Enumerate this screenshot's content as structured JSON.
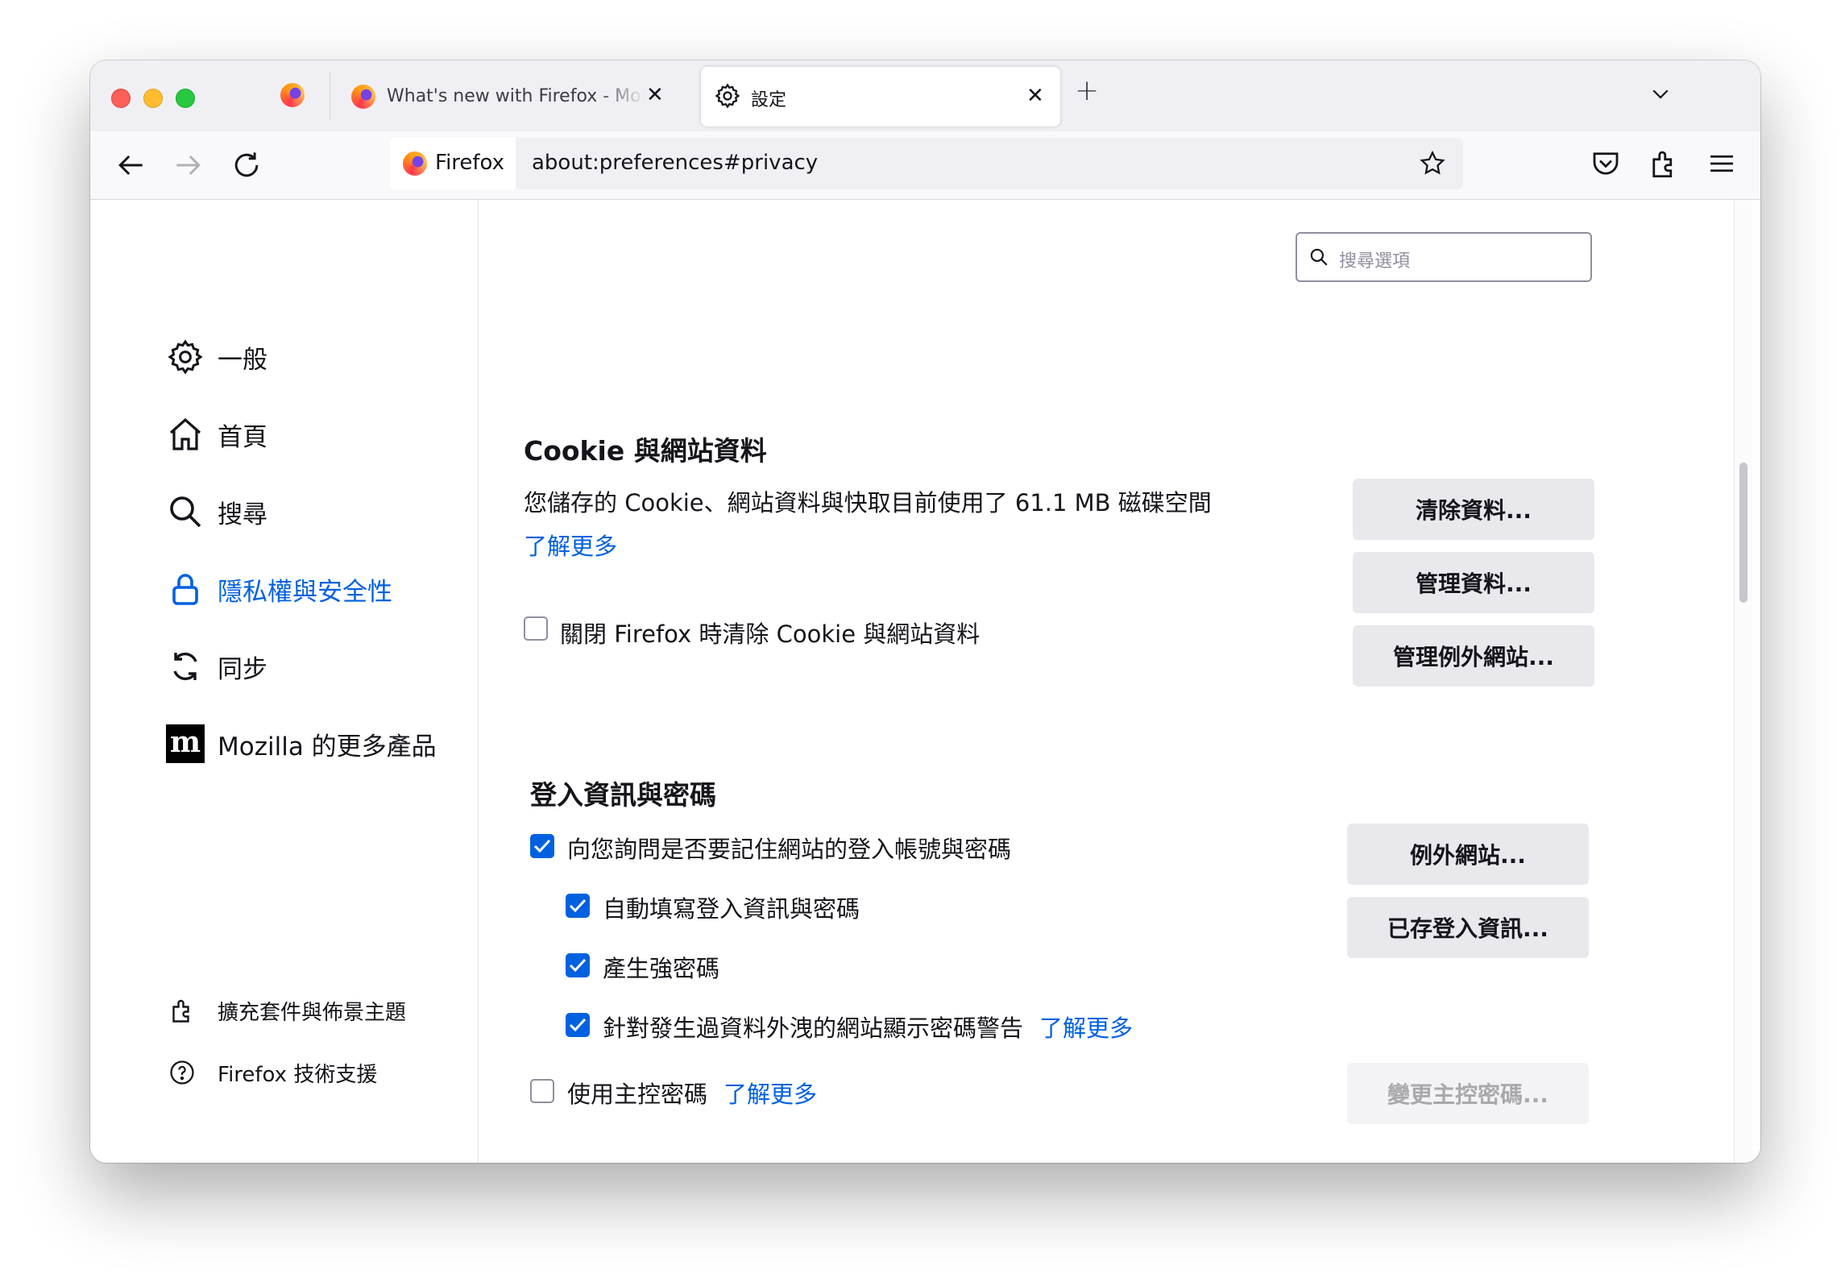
{
  "tabs": [
    {
      "title": "What's new with Firefox - More privacy, less clutter",
      "active": false
    },
    {
      "title": "設定",
      "active": true
    }
  ],
  "urlbar": {
    "identity_label": "Firefox",
    "url": "about:preferences#privacy"
  },
  "search": {
    "placeholder": "搜尋選項"
  },
  "sidebar": {
    "categories": [
      {
        "label": "一般",
        "icon": "gear-icon"
      },
      {
        "label": "首頁",
        "icon": "home-icon"
      },
      {
        "label": "搜尋",
        "icon": "search-icon"
      },
      {
        "label": "隱私權與安全性",
        "icon": "lock-icon",
        "selected": true
      },
      {
        "label": "同步",
        "icon": "sync-icon"
      },
      {
        "label": "Mozilla 的更多產品",
        "icon": "mozilla-icon"
      }
    ],
    "footer": [
      {
        "label": "擴充套件與佈景主題",
        "icon": "extension-icon"
      },
      {
        "label": "Firefox 技術支援",
        "icon": "help-icon"
      }
    ]
  },
  "cookies": {
    "heading": "Cookie 與網站資料",
    "usage_text": "您儲存的 Cookie、網站資料與快取目前使用了 61.1 MB 磁碟空間",
    "learn_more": "了解更多",
    "clear_on_close": {
      "label": "關閉 Firefox 時清除 Cookie 與網站資料",
      "checked": false
    },
    "buttons": {
      "clear": "清除資料...",
      "manage": "管理資料...",
      "exceptions": "管理例外網站..."
    }
  },
  "logins": {
    "heading": "登入資訊與密碼",
    "ask_save": {
      "label": "向您詢問是否要記住網站的登入帳號與密碼",
      "checked": true
    },
    "autofill": {
      "label": "自動填寫登入資訊與密碼",
      "checked": true
    },
    "generate": {
      "label": "產生強密碼",
      "checked": true
    },
    "breach_alerts": {
      "label": "針對發生過資料外洩的網站顯示密碼警告",
      "checked": true,
      "learn_more": "了解更多"
    },
    "primary_password": {
      "label": "使用主控密碼",
      "checked": false,
      "learn_more": "了解更多"
    },
    "buttons": {
      "exceptions": "例外網站...",
      "saved_logins": "已存登入資訊...",
      "change_primary": "變更主控密碼..."
    }
  },
  "colors": {
    "accent": "#0061e0",
    "button_bg": "#e9e9ed"
  }
}
